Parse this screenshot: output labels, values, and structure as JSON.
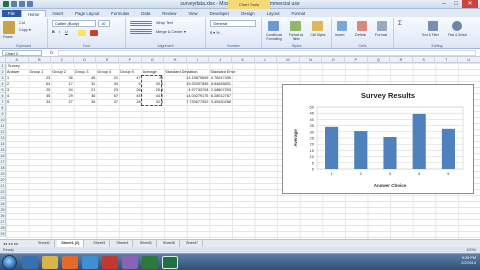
{
  "window": {
    "title": "surveydata.xlsx - Microsoft Excel non-commercial use",
    "context_tab": "Chart Tools",
    "buttons": {
      "minimize": "–",
      "maximize": "□",
      "close": "✕"
    }
  },
  "ribbon": {
    "tabs": [
      "File",
      "Home",
      "Insert",
      "Page Layout",
      "Formulas",
      "Data",
      "Review",
      "View",
      "Developer",
      "Design",
      "Layout",
      "Format"
    ],
    "active_tab": "Home",
    "clipboard": {
      "cut": "Cut",
      "copy": "Copy ▾",
      "paste": "Paste",
      "label": "Clipboard"
    },
    "font": {
      "name": "Calibri (Body)",
      "size": "10",
      "label": "Font"
    },
    "alignment": {
      "wrap": "Wrap Text",
      "merge": "Merge & Center ▾",
      "label": "Alignment"
    },
    "number": {
      "format": "General",
      "label": "Number"
    },
    "styles": {
      "cond": "Conditional Formatting",
      "table": "Format as Table",
      "cell": "Cell Styles",
      "label": "Styles"
    },
    "cells": {
      "insert": "Insert",
      "delete": "Delete",
      "format": "Format",
      "label": "Cells"
    },
    "editing": {
      "sort": "Sort & Filter",
      "find": "Find & Select",
      "label": "Editing"
    }
  },
  "formula_bar": {
    "name_box": "Chart 2",
    "fx": "fx",
    "value": ""
  },
  "columns": [
    "A",
    "B",
    "C",
    "D",
    "E",
    "F",
    "G",
    "H",
    "I",
    "J",
    "K",
    "L",
    "M",
    "N",
    "O",
    "P",
    "Q",
    "R",
    "S",
    "T",
    "U"
  ],
  "rows": [
    "1",
    "2",
    "3",
    "4",
    "5",
    "6",
    "7",
    "8",
    "9",
    "10",
    "11",
    "12",
    "13",
    "14",
    "15",
    "16",
    "17",
    "18",
    "19",
    "20",
    "21",
    "22",
    "23",
    "24",
    "25",
    "26",
    "27",
    "28",
    "29"
  ],
  "sheet": {
    "a1": "Survey",
    "headers": [
      "Answer",
      "Group 1",
      "Group 2",
      "Group 3",
      "Group 4",
      "Group 5",
      "Average",
      "Standard Deviation",
      "Standard Error"
    ],
    "data_rows": [
      [
        "1",
        "23",
        "36",
        "45",
        "21",
        "47",
        "34",
        "12.15575699",
        "4.78247495"
      ],
      [
        "2",
        "64",
        "17",
        "32",
        "34",
        "6",
        "30.6",
        "19.33397836",
        "8.64645831"
      ],
      [
        "3",
        "25",
        "34",
        "21",
        "23",
        "26",
        "25.8",
        "4.97733708",
        "2.08807293"
      ],
      [
        "4",
        "45",
        "29",
        "36",
        "67",
        "45",
        "44.4",
        "14.04279175",
        "6.28012767"
      ],
      [
        "5",
        "34",
        "27",
        "36",
        "37",
        "28",
        "32.4",
        "7.730677502",
        "3.45430288"
      ]
    ]
  },
  "chart_data": {
    "type": "bar",
    "title": "Survey Results",
    "xlabel": "Answer Choice",
    "ylabel": "Average",
    "categories": [
      "1",
      "2",
      "3",
      "4",
      "5"
    ],
    "values": [
      34,
      30.6,
      25.8,
      44.4,
      32.4
    ],
    "ylim": [
      0,
      50
    ],
    "yticks": [
      "0",
      "5",
      "10",
      "15",
      "20",
      "25",
      "30",
      "35",
      "40",
      "45",
      "50"
    ],
    "grid": true,
    "bar_color": "#4f81bd"
  },
  "sheet_tabs": [
    "Sheet1",
    "Sheet1 (2)",
    "Sheet3",
    "Sheet4",
    "Sheet5",
    "Sheet6",
    "Sheet7"
  ],
  "active_sheet": "Sheet1 (2)",
  "status": {
    "mode": "Ready",
    "zoom": "100%"
  },
  "taskbar": {
    "time": "9:26 PM",
    "date": "2/2/2014"
  },
  "colors": {
    "accent": "#2a5aa7",
    "excel_green": "#1e7145"
  }
}
